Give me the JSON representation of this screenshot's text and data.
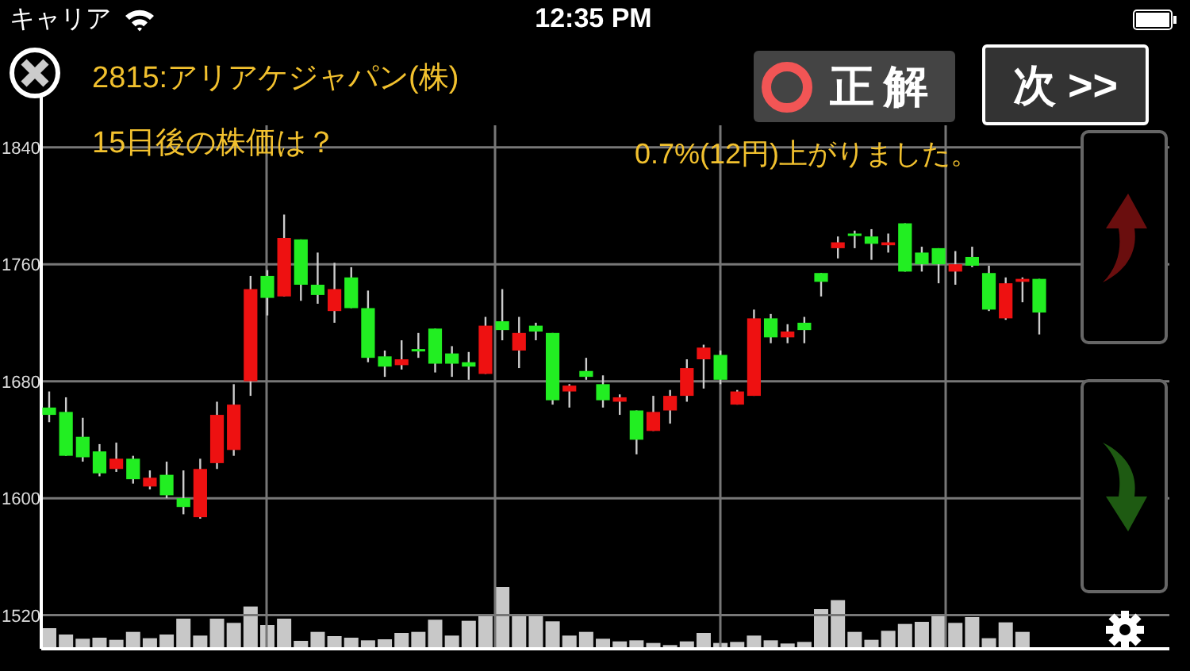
{
  "status_bar": {
    "carrier": "キャリア",
    "time": "12:35 PM"
  },
  "header": {
    "title": "2815:アリアケジャパン(株)",
    "question": "15日後の株価は？"
  },
  "answer": {
    "kind": "correct",
    "label": "正解",
    "result": "0.7%(12円)上がりました。"
  },
  "next_button": {
    "label": "次 >>"
  },
  "chart": {
    "chart_data": {
      "type": "candlestick",
      "ylim": [
        1497,
        1893
      ],
      "yticks": [
        1840,
        1760,
        1680,
        1600,
        1520
      ],
      "grid": true,
      "ohlc": [
        [
          1662,
          1673,
          1652,
          1657
        ],
        [
          1659,
          1669,
          1629,
          1629
        ],
        [
          1642,
          1655,
          1625,
          1628
        ],
        [
          1632,
          1637,
          1615,
          1617
        ],
        [
          1620,
          1638,
          1618,
          1627
        ],
        [
          1627,
          1629,
          1610,
          1613
        ],
        [
          1608,
          1619,
          1606,
          1614
        ],
        [
          1616,
          1625,
          1600,
          1602
        ],
        [
          1600,
          1619,
          1589,
          1594
        ],
        [
          1587,
          1627,
          1586,
          1620
        ],
        [
          1624,
          1666,
          1620,
          1657
        ],
        [
          1633,
          1678,
          1629,
          1664
        ],
        [
          1680,
          1752,
          1670,
          1743
        ],
        [
          1752,
          1756,
          1725,
          1737
        ],
        [
          1738,
          1794,
          1738,
          1778
        ],
        [
          1777,
          1777,
          1735,
          1746
        ],
        [
          1746,
          1768,
          1733,
          1739
        ],
        [
          1728,
          1761,
          1720,
          1743
        ],
        [
          1751,
          1758,
          1730,
          1730
        ],
        [
          1730,
          1742,
          1693,
          1696
        ],
        [
          1697,
          1701,
          1683,
          1690
        ],
        [
          1691,
          1708,
          1688,
          1695
        ],
        [
          1702,
          1713,
          1696,
          1701
        ],
        [
          1716,
          1716,
          1686,
          1692
        ],
        [
          1699,
          1704,
          1683,
          1692
        ],
        [
          1693,
          1700,
          1681,
          1690
        ],
        [
          1685,
          1724,
          1685,
          1718
        ],
        [
          1721,
          1743,
          1708,
          1715
        ],
        [
          1701,
          1724,
          1689,
          1713
        ],
        [
          1718,
          1720,
          1708,
          1714
        ],
        [
          1713,
          1713,
          1664,
          1667
        ],
        [
          1673,
          1678,
          1662,
          1677
        ],
        [
          1687,
          1696,
          1681,
          1683
        ],
        [
          1678,
          1684,
          1662,
          1667
        ],
        [
          1666,
          1671,
          1657,
          1669
        ],
        [
          1660,
          1660,
          1630,
          1640
        ],
        [
          1646,
          1670,
          1646,
          1659
        ],
        [
          1660,
          1674,
          1651,
          1670
        ],
        [
          1670,
          1695,
          1666,
          1689
        ],
        [
          1695,
          1705,
          1675,
          1703
        ],
        [
          1698,
          1701,
          1678,
          1681
        ],
        [
          1664,
          1674,
          1664,
          1673
        ],
        [
          1670,
          1729,
          1670,
          1723
        ],
        [
          1723,
          1726,
          1706,
          1710
        ],
        [
          1710,
          1719,
          1706,
          1714
        ],
        [
          1720,
          1724,
          1706,
          1715
        ],
        [
          1754,
          1754,
          1738,
          1748
        ],
        [
          1771,
          1779,
          1764,
          1775
        ],
        [
          1781,
          1783,
          1771,
          1780
        ],
        [
          1779,
          1784,
          1763,
          1774
        ],
        [
          1773,
          1781,
          1768,
          1775
        ],
        [
          1788,
          1788,
          1755,
          1755
        ],
        [
          1768,
          1772,
          1755,
          1760
        ],
        [
          1771,
          1771,
          1747,
          1760
        ],
        [
          1755,
          1769,
          1746,
          1760
        ],
        [
          1765,
          1772,
          1758,
          1759
        ],
        [
          1754,
          1759,
          1728,
          1729
        ],
        [
          1723,
          1751,
          1722,
          1747
        ],
        [
          1748,
          1751,
          1734,
          1750
        ],
        [
          1750,
          1750,
          1712,
          1727
        ]
      ]
    }
  },
  "guess_buttons": [
    {
      "kind": "up"
    },
    {
      "kind": "down"
    }
  ]
}
